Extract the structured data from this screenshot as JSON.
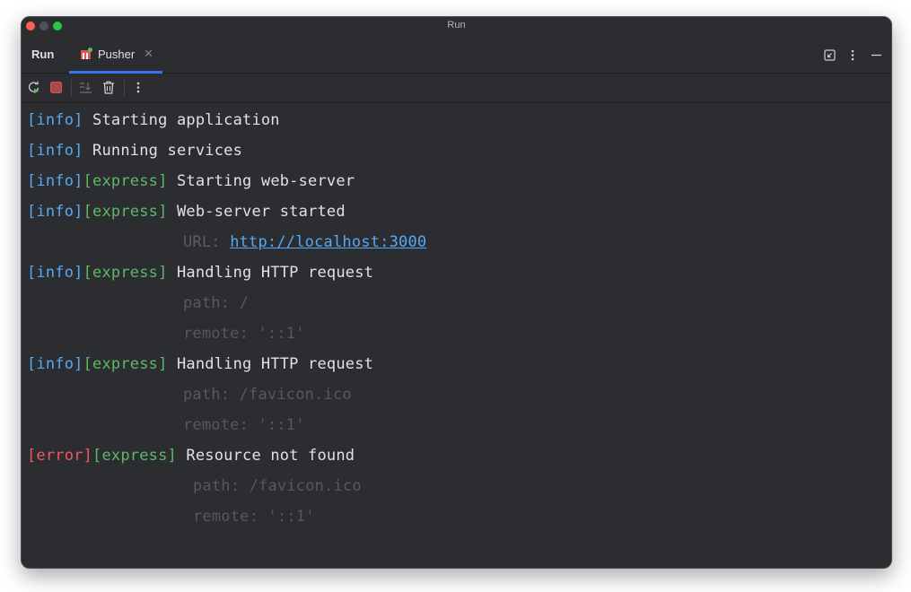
{
  "window": {
    "title": "Run"
  },
  "tabbar": {
    "title": "Run",
    "tabs": [
      {
        "label": "Pusher",
        "active": true
      }
    ]
  },
  "console": {
    "lines": [
      {
        "level": "[info]",
        "tag": "",
        "sep": " ",
        "text": "Starting application"
      },
      {
        "level": "[info]",
        "tag": "",
        "sep": " ",
        "text": "Running services"
      },
      {
        "level": "[info]",
        "tag": "[express]",
        "sep": " ",
        "text": "Starting web-server"
      },
      {
        "level": "[info]",
        "tag": "[express]",
        "sep": " ",
        "text": "Web-server started"
      },
      {
        "detail_label": "URL: ",
        "url": "http://localhost:3000"
      },
      {
        "level": "[info]",
        "tag": "[express]",
        "sep": " ",
        "text": "Handling HTTP request"
      },
      {
        "detail": "path: /"
      },
      {
        "detail": "remote: '::1'"
      },
      {
        "level": "[info]",
        "tag": "[express]",
        "sep": " ",
        "text": "Handling HTTP request"
      },
      {
        "detail": "path: /favicon.ico"
      },
      {
        "detail": "remote: '::1'"
      },
      {
        "level": "[error]",
        "tag": "[express]",
        "sep": " ",
        "text": "Resource not found"
      },
      {
        "detail": "path: /favicon.ico"
      },
      {
        "detail": "remote: '::1'"
      }
    ]
  },
  "colors": {
    "background": "#2b2d30",
    "info": "#56a8f5",
    "error": "#f75464",
    "tag": "#5fb865",
    "accent": "#3574f0"
  }
}
